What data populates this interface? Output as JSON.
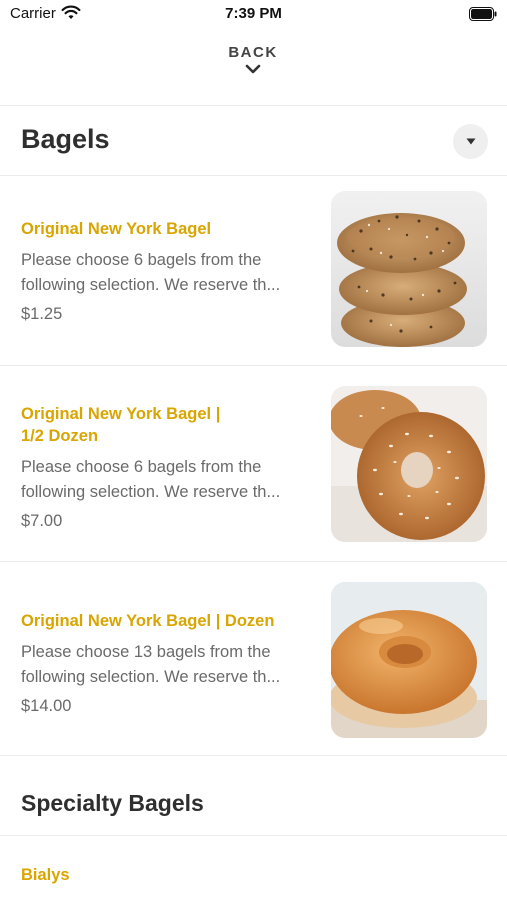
{
  "status_bar": {
    "carrier": "Carrier",
    "time": "7:39 PM"
  },
  "nav": {
    "back_label": "BACK"
  },
  "section": {
    "title": "Bagels"
  },
  "items": [
    {
      "name_lines": [
        "Original New York Bagel"
      ],
      "desc_lines": [
        "Please choose 6 bagels from the",
        "following selection. We reserve th..."
      ],
      "price": "$1.25",
      "image": "everything-bagel-stack"
    },
    {
      "name_lines": [
        "Original New York Bagel |",
        "1/2 Dozen"
      ],
      "desc_lines": [
        "Please choose 6 bagels from the",
        "following selection. We reserve th..."
      ],
      "price": "$7.00",
      "image": "sesame-bagel"
    },
    {
      "name_lines": [
        "Original New York Bagel | Dozen"
      ],
      "desc_lines": [
        "Please choose 13 bagels from the",
        "following selection. We reserve th..."
      ],
      "price": "$14.00",
      "image": "plain-bagel"
    }
  ],
  "specialty_section": {
    "title": "Specialty Bagels"
  },
  "bialys": {
    "label": "Bialys"
  },
  "colors": {
    "accent": "#d9a500",
    "text_muted": "#6a6a6a",
    "divider": "#ececec"
  }
}
